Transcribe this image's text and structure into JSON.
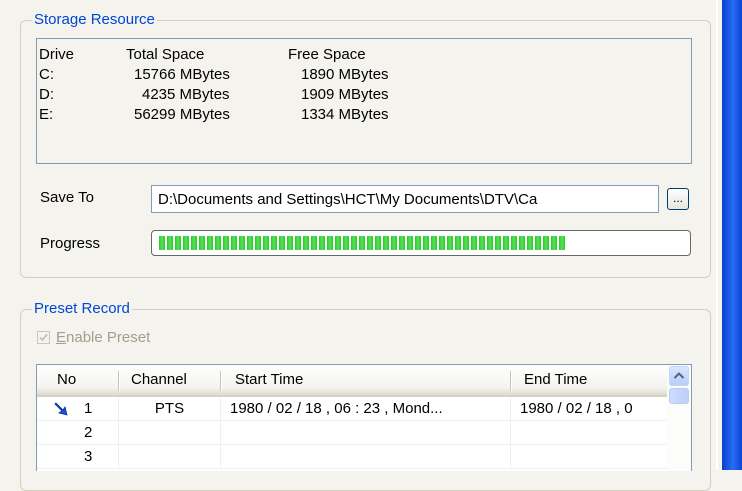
{
  "storage": {
    "title": "Storage Resource",
    "columns": {
      "drive": "Drive",
      "total": "Total Space",
      "free": "Free Space"
    },
    "drives": [
      {
        "drive": "C:",
        "total": "15766 MBytes",
        "free": "1890 MBytes"
      },
      {
        "drive": "D:",
        "total": "4235 MBytes",
        "free": "1909 MBytes"
      },
      {
        "drive": "E:",
        "total": "56299 MBytes",
        "free": "1334 MBytes"
      }
    ],
    "save_to_label": "Save To",
    "save_to_value": "D:\\Documents and Settings\\HCT\\My Documents\\DTV\\Ca",
    "browse_label": "...",
    "progress_label": "Progress",
    "progress_fraction": 0.78
  },
  "preset": {
    "title": "Preset Record",
    "enable_label_underlined": "E",
    "enable_label_rest": "nable Preset",
    "enable_checked": true,
    "enable_disabled": true,
    "columns": {
      "no": "No",
      "channel": "Channel",
      "start": "Start Time",
      "end": "End Time"
    },
    "rows": [
      {
        "no": "1",
        "channel": "PTS",
        "start": "1980 / 02 / 18 , 06 : 23 , Mond...",
        "end": "1980 / 02 / 18 , 0",
        "active": true
      },
      {
        "no": "2",
        "channel": "",
        "start": "",
        "end": "",
        "active": false
      },
      {
        "no": "3",
        "channel": "",
        "start": "",
        "end": "",
        "active": false
      }
    ]
  },
  "colors": {
    "group_title": "#0046d5",
    "progress_green": "#2ec82e",
    "border_blue": "#7f9db9"
  },
  "icons": {
    "row_indicator": "record-arrow-icon",
    "scroll_up": "scroll-up-arrow-icon",
    "checkbox": "checkmark-icon"
  }
}
